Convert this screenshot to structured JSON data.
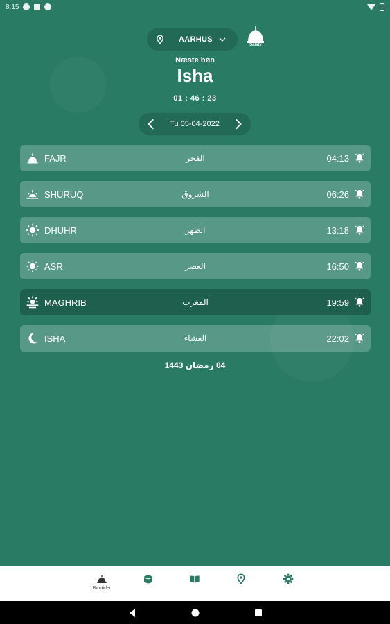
{
  "status_bar": {
    "time": "8:15"
  },
  "header": {
    "location": "AARHUS",
    "brand": "Salaty",
    "next_prayer_label": "Næste bøn",
    "next_prayer_name": "Isha",
    "countdown": "01 : 46 : 23",
    "date": "Tu 05-04-2022"
  },
  "prayers": [
    {
      "name": "FAJR",
      "arabic": "الفجر",
      "time": "04:13",
      "icon": "fajr-icon",
      "active": false
    },
    {
      "name": "SHURUQ",
      "arabic": "الشروق",
      "time": "06:26",
      "icon": "sunrise-icon",
      "active": false
    },
    {
      "name": "DHUHR",
      "arabic": "الظهر",
      "time": "13:18",
      "icon": "sun-icon",
      "active": false
    },
    {
      "name": "ASR",
      "arabic": "العصر",
      "time": "16:50",
      "icon": "sun-small-icon",
      "active": false
    },
    {
      "name": "MAGHRIB",
      "arabic": "المغرب",
      "time": "19:59",
      "icon": "sunset-icon",
      "active": true
    },
    {
      "name": "ISHA",
      "arabic": "العشاء",
      "time": "22:02",
      "icon": "moon-icon",
      "active": false
    }
  ],
  "hijri_date": "04 رمضان 1443",
  "bottom_nav": {
    "items": [
      {
        "label": "Bøntider",
        "icon": "mosque-icon"
      },
      {
        "label": "",
        "icon": "kaaba-icon"
      },
      {
        "label": "",
        "icon": "quran-icon"
      },
      {
        "label": "",
        "icon": "location-icon"
      },
      {
        "label": "",
        "icon": "gear-icon"
      }
    ]
  },
  "colors": {
    "background": "#2a7b64",
    "pill": "#226a56",
    "row": "rgba(255,255,255,0.22)",
    "active_row": "#1f5f4d",
    "nav_icon": "#2a7b64"
  }
}
